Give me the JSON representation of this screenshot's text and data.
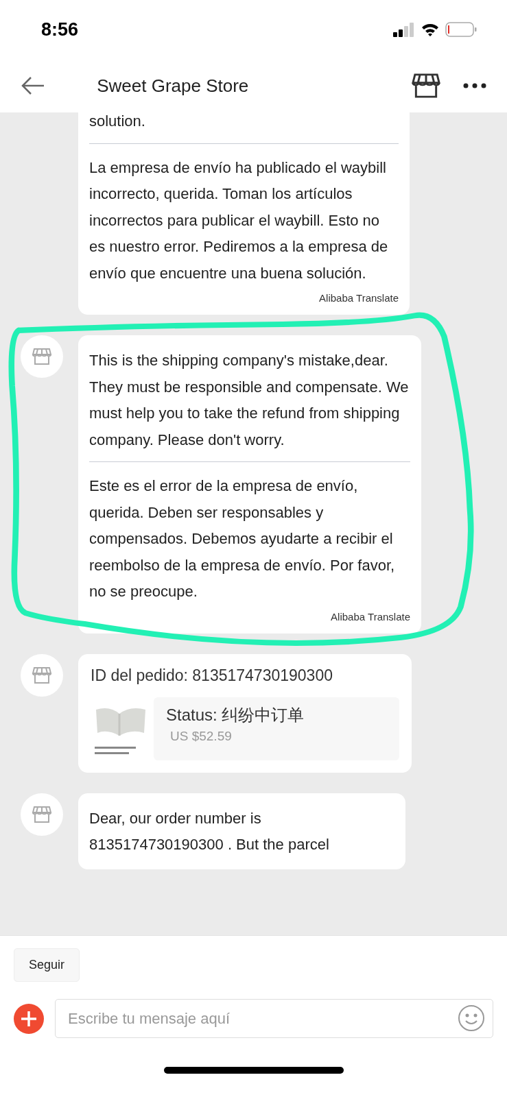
{
  "status_bar": {
    "time": "8:56"
  },
  "header": {
    "title": "Sweet Grape Store"
  },
  "messages": [
    {
      "kind": "translated",
      "avatar": false,
      "highlighted": false,
      "original": "solution.",
      "translation": "La empresa de envío ha publicado el waybill incorrecto, querida. Toman los artículos incorrectos para publicar el waybill. Esto no es nuestro error. Pediremos a la empresa de envío que encuentre una buena solución.",
      "translator": "Alibaba Translate"
    },
    {
      "kind": "translated",
      "avatar": true,
      "highlighted": true,
      "original": "This is the shipping company's mistake,dear. They must be responsible and compensate. We must help you to take the refund from shipping company. Please don't worry.",
      "translation": "Este es el error de la empresa de envío, querida. Deben ser responsables y compensados. Debemos ayudarte a recibir el reembolso de la empresa de envío. Por favor, no se preocupe.",
      "translator": "Alibaba Translate"
    },
    {
      "kind": "order",
      "avatar": true,
      "highlighted": false,
      "order_id": "ID del pedido: 8135174730190300",
      "status_label": "Status:",
      "status": "纠纷中订单",
      "price": "US $52.59"
    },
    {
      "kind": "text",
      "avatar": true,
      "highlighted": false,
      "text": "Dear, our order number is 8135174730190300 . But the parcel"
    }
  ],
  "follow_button": "Seguir",
  "composer": {
    "placeholder": "Escribe tu mensaje aquí"
  }
}
